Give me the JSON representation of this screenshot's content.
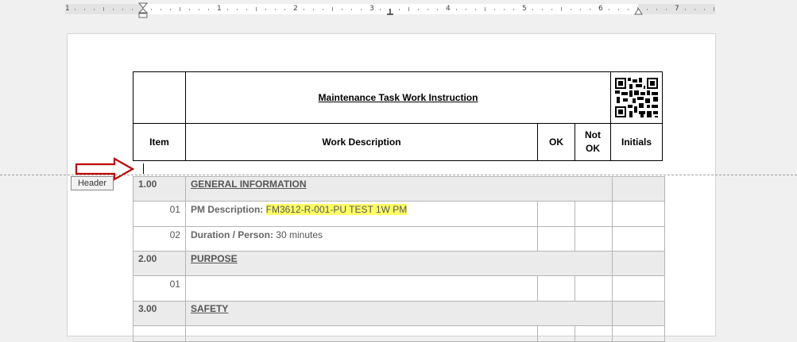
{
  "ruler": {
    "numbers": [
      "1",
      "1",
      "2",
      "3",
      "4",
      "5",
      "6",
      "7"
    ]
  },
  "header_tag": "Header",
  "header_table": {
    "title": "Maintenance Task Work Instruction",
    "columns": [
      "Item",
      "Work Description",
      "OK",
      "Not OK",
      "Initials"
    ],
    "qr_icon": "qr-code-icon"
  },
  "sections": [
    {
      "number": "1.00",
      "title": "GENERAL INFORMATION",
      "items": [
        {
          "num": "01",
          "label": "PM Description:",
          "value": "FM3612-R-001-PU TEST 1W PM",
          "highlight": true
        },
        {
          "num": "02",
          "label": "Duration / Person:",
          "value": "30 minutes",
          "highlight": false
        }
      ]
    },
    {
      "number": "2.00",
      "title": "PURPOSE",
      "items": [
        {
          "num": "01",
          "label": "",
          "value": "",
          "highlight": false
        }
      ]
    },
    {
      "number": "3.00",
      "title": "SAFETY",
      "items": []
    }
  ],
  "colors": {
    "highlight": "#ffff66",
    "section_bg": "#ebebeb",
    "arrow": "#c00000"
  }
}
